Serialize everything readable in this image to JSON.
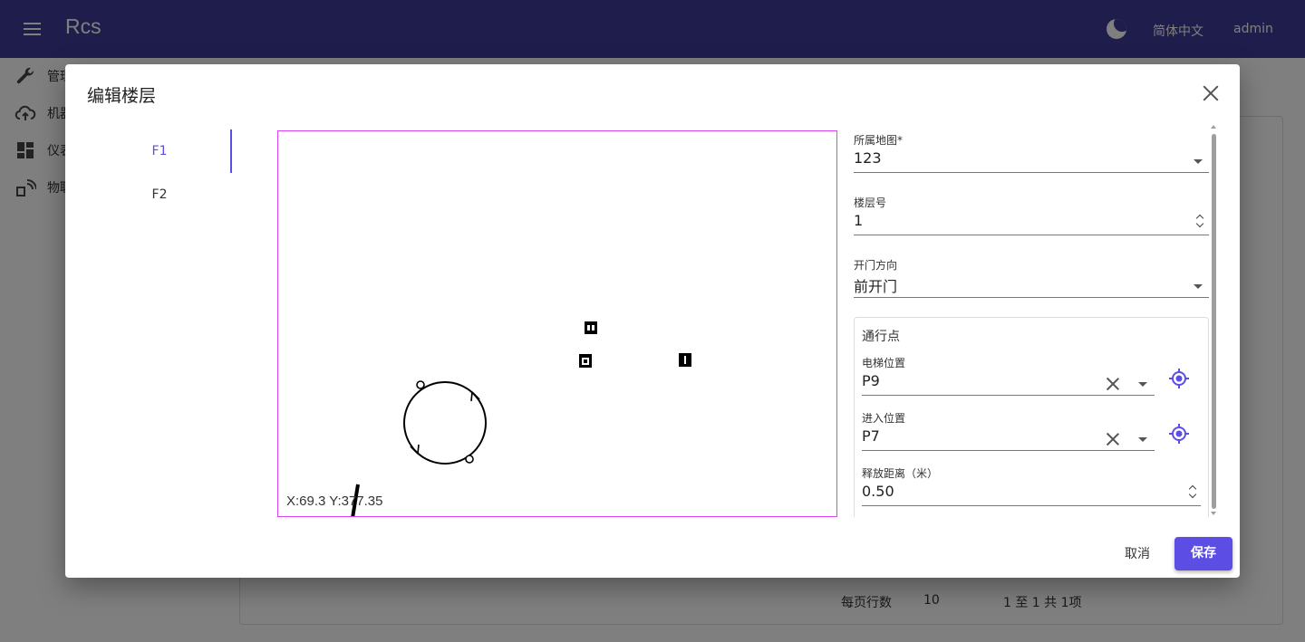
{
  "appbar": {
    "title": "Rcs",
    "language": "简体中文",
    "user": "admin",
    "theme_icon": "moon-icon"
  },
  "sidebar": {
    "items": [
      {
        "label": "管理",
        "icon": "wrench-icon"
      },
      {
        "label": "机器",
        "icon": "cloud-upload-icon"
      },
      {
        "label": "仪表",
        "icon": "dashboard-icon"
      },
      {
        "label": "物联",
        "icon": "iot-icon"
      }
    ]
  },
  "pager": {
    "rows_label": "每页行数",
    "rows_value": "10",
    "range": "1 至 1 共 1项"
  },
  "dialog": {
    "title": "编辑楼层",
    "floors": [
      {
        "label": "F1",
        "active": true
      },
      {
        "label": "F2",
        "active": false
      }
    ],
    "map": {
      "coords": "X:69.3 Y:377.35"
    },
    "form": {
      "map_field": {
        "label": "所属地图*",
        "value": "123"
      },
      "floor_no": {
        "label": "楼层号",
        "value": "1"
      },
      "door_dir": {
        "label": "开门方向",
        "value": "前开门"
      },
      "pass_points": {
        "title": "通行点",
        "elevator_pos": {
          "label": "电梯位置",
          "value": "P9"
        },
        "enter_pos": {
          "label": "进入位置",
          "value": "P7"
        },
        "release_dist": {
          "label": "释放距离（米）",
          "value": "0.50"
        }
      }
    },
    "cancel_label": "取消",
    "save_label": "保存"
  },
  "colors": {
    "appbar": "#3f3a97",
    "accent": "#5c4ee5",
    "map_border": "#e040fb"
  }
}
